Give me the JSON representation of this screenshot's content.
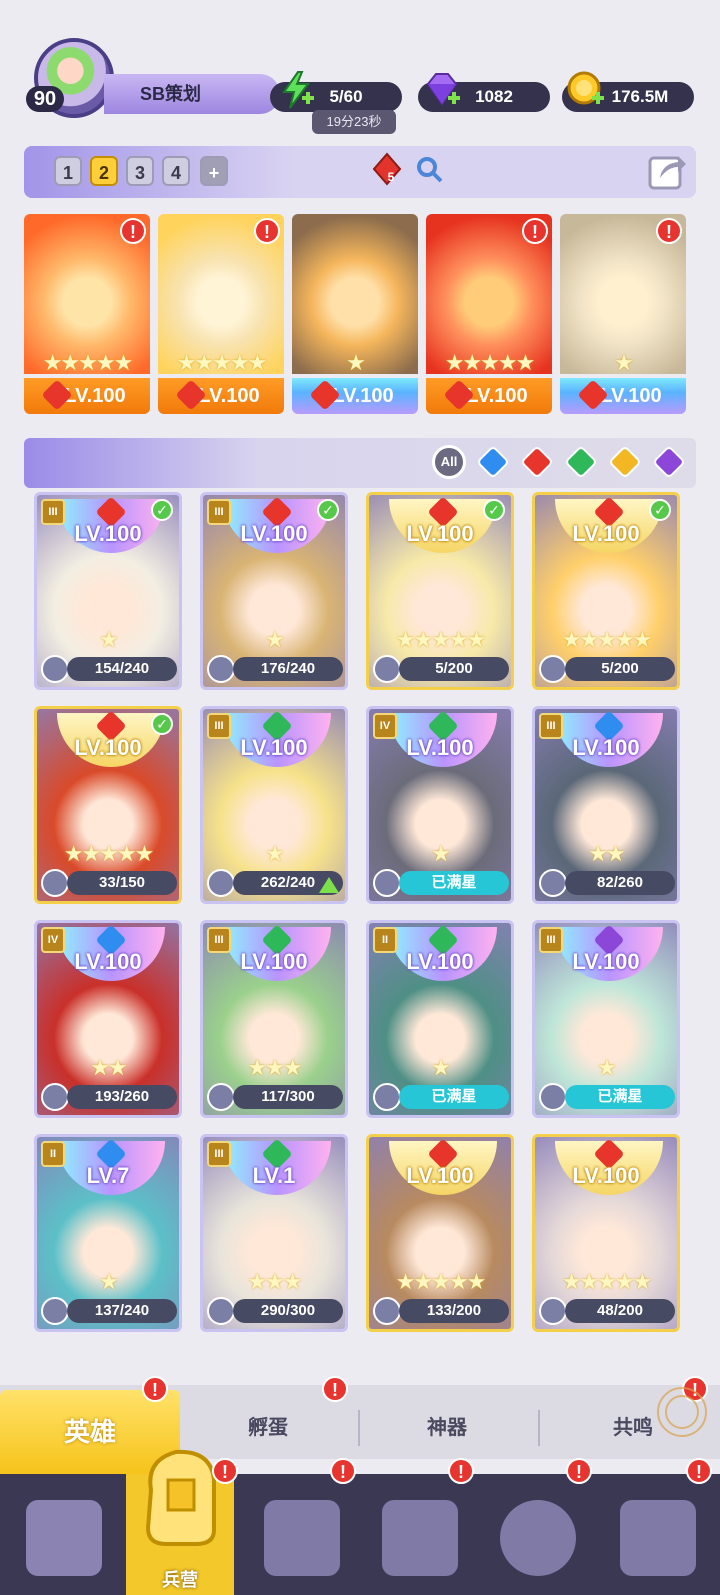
{
  "player": {
    "level": "90",
    "name": "SB策划"
  },
  "resources": {
    "energy": "5/60",
    "energy_timer": "19分23秒",
    "gems": "1082",
    "gold": "176.5M"
  },
  "teams": {
    "tabs": [
      "1",
      "2",
      "3",
      "4",
      "+"
    ],
    "active": "2",
    "item_count": "5"
  },
  "lineup": [
    {
      "level": "LV.100",
      "stars": "★★★★★",
      "style": "orange",
      "alert": "!"
    },
    {
      "level": "LV.100",
      "stars": "★★★★★",
      "style": "orange",
      "alert": "!"
    },
    {
      "level": "LV.100",
      "stars": "★",
      "style": "cyan",
      "alert": ""
    },
    {
      "level": "LV.100",
      "stars": "★★★★★",
      "style": "orange",
      "alert": "!"
    },
    {
      "level": "LV.100",
      "stars": "★",
      "style": "cyan",
      "alert": "!"
    }
  ],
  "filters": [
    "All",
    "water",
    "fire",
    "nature",
    "light",
    "dark"
  ],
  "heroes": [
    {
      "level": "LV.100",
      "shards": "154/240",
      "stars": "★",
      "rank": "III",
      "element": "fire",
      "checked": true
    },
    {
      "level": "LV.100",
      "shards": "176/240",
      "stars": "★",
      "rank": "III",
      "element": "fire",
      "checked": true
    },
    {
      "level": "LV.100",
      "shards": "5/200",
      "stars": "★★★★★",
      "rank": "",
      "element": "fire",
      "checked": true
    },
    {
      "level": "LV.100",
      "shards": "5/200",
      "stars": "★★★★★",
      "rank": "",
      "element": "fire",
      "checked": true
    },
    {
      "level": "LV.100",
      "shards": "33/150",
      "stars": "★★★★★",
      "rank": "",
      "element": "fire",
      "checked": true
    },
    {
      "level": "LV.100",
      "shards": "262/240",
      "stars": "★",
      "rank": "III",
      "element": "nature",
      "checked": false
    },
    {
      "level": "LV.100",
      "shards": "已满星",
      "stars": "★",
      "rank": "IV",
      "element": "nature",
      "checked": false
    },
    {
      "level": "LV.100",
      "shards": "82/260",
      "stars": "★★",
      "rank": "III",
      "element": "water",
      "checked": false
    },
    {
      "level": "LV.100",
      "shards": "193/260",
      "stars": "★★",
      "rank": "IV",
      "element": "water",
      "checked": false
    },
    {
      "level": "LV.100",
      "shards": "117/300",
      "stars": "★★★",
      "rank": "III",
      "element": "nature",
      "checked": false
    },
    {
      "level": "LV.100",
      "shards": "已满星",
      "stars": "★",
      "rank": "II",
      "element": "nature",
      "checked": false
    },
    {
      "level": "LV.100",
      "shards": "已满星",
      "stars": "★",
      "rank": "III",
      "element": "dark",
      "checked": false
    },
    {
      "level": "LV.7",
      "shards": "137/240",
      "stars": "★",
      "rank": "II",
      "element": "water",
      "checked": false
    },
    {
      "level": "LV.1",
      "shards": "290/300",
      "stars": "★★★",
      "rank": "III",
      "element": "nature",
      "checked": false
    },
    {
      "level": "LV.100",
      "shards": "133/200",
      "stars": "★★★★★",
      "rank": "",
      "element": "fire",
      "checked": false
    },
    {
      "level": "LV.100",
      "shards": "48/200",
      "stars": "★★★★★",
      "rank": "",
      "element": "fire",
      "checked": false
    }
  ],
  "subtabs": {
    "heroes": "英雄",
    "eggs": "孵蛋",
    "artifacts": "神器",
    "resonance": "共鸣"
  },
  "nav": {
    "barracks": "兵营"
  },
  "colors": {
    "fire": "#e8352b",
    "water": "#2f8df0",
    "nature": "#2fb85a",
    "light": "#f2b722",
    "dark": "#8c46d8"
  }
}
